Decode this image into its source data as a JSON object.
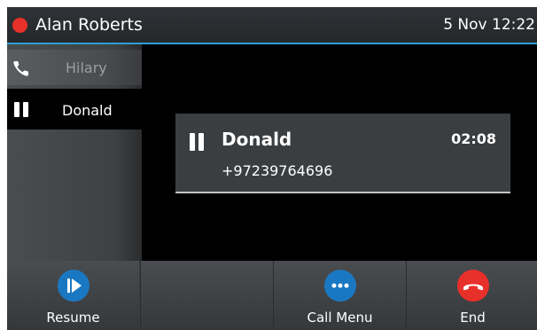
{
  "header": {
    "user_name": "Alan Roberts",
    "datetime": "5 Nov 12:22",
    "status_color": "#e8302a"
  },
  "calls": [
    {
      "name": "Hilary",
      "icon": "phone-icon",
      "state": "active"
    },
    {
      "name": "Donald",
      "icon": "pause-icon",
      "state": "held",
      "selected": true
    }
  ],
  "call_card": {
    "name": "Donald",
    "number": "+97239764696",
    "timer": "02:08",
    "icon": "pause-icon"
  },
  "softkeys": [
    {
      "label": "Resume",
      "icon": "resume-icon",
      "color": "#1a78c2"
    },
    {
      "label": "",
      "icon": "",
      "color": ""
    },
    {
      "label": "Call Menu",
      "icon": "more-icon",
      "color": "#1a78c2"
    },
    {
      "label": "End",
      "icon": "end-call-icon",
      "color": "#e8302a"
    }
  ]
}
